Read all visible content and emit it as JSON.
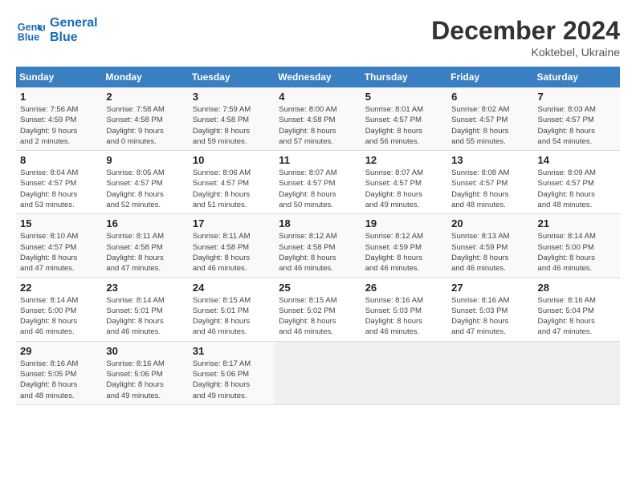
{
  "header": {
    "logo_line1": "General",
    "logo_line2": "Blue",
    "month": "December 2024",
    "location": "Koktebel, Ukraine"
  },
  "weekdays": [
    "Sunday",
    "Monday",
    "Tuesday",
    "Wednesday",
    "Thursday",
    "Friday",
    "Saturday"
  ],
  "weeks": [
    [
      {
        "day": "1",
        "sunrise": "7:56 AM",
        "sunset": "4:59 PM",
        "daylight": "9 hours and 2 minutes."
      },
      {
        "day": "2",
        "sunrise": "7:58 AM",
        "sunset": "4:58 PM",
        "daylight": "9 hours and 0 minutes."
      },
      {
        "day": "3",
        "sunrise": "7:59 AM",
        "sunset": "4:58 PM",
        "daylight": "8 hours and 59 minutes."
      },
      {
        "day": "4",
        "sunrise": "8:00 AM",
        "sunset": "4:58 PM",
        "daylight": "8 hours and 57 minutes."
      },
      {
        "day": "5",
        "sunrise": "8:01 AM",
        "sunset": "4:57 PM",
        "daylight": "8 hours and 56 minutes."
      },
      {
        "day": "6",
        "sunrise": "8:02 AM",
        "sunset": "4:57 PM",
        "daylight": "8 hours and 55 minutes."
      },
      {
        "day": "7",
        "sunrise": "8:03 AM",
        "sunset": "4:57 PM",
        "daylight": "8 hours and 54 minutes."
      }
    ],
    [
      {
        "day": "8",
        "sunrise": "8:04 AM",
        "sunset": "4:57 PM",
        "daylight": "8 hours and 53 minutes."
      },
      {
        "day": "9",
        "sunrise": "8:05 AM",
        "sunset": "4:57 PM",
        "daylight": "8 hours and 52 minutes."
      },
      {
        "day": "10",
        "sunrise": "8:06 AM",
        "sunset": "4:57 PM",
        "daylight": "8 hours and 51 minutes."
      },
      {
        "day": "11",
        "sunrise": "8:07 AM",
        "sunset": "4:57 PM",
        "daylight": "8 hours and 50 minutes."
      },
      {
        "day": "12",
        "sunrise": "8:07 AM",
        "sunset": "4:57 PM",
        "daylight": "8 hours and 49 minutes."
      },
      {
        "day": "13",
        "sunrise": "8:08 AM",
        "sunset": "4:57 PM",
        "daylight": "8 hours and 48 minutes."
      },
      {
        "day": "14",
        "sunrise": "8:09 AM",
        "sunset": "4:57 PM",
        "daylight": "8 hours and 48 minutes."
      }
    ],
    [
      {
        "day": "15",
        "sunrise": "8:10 AM",
        "sunset": "4:57 PM",
        "daylight": "8 hours and 47 minutes."
      },
      {
        "day": "16",
        "sunrise": "8:11 AM",
        "sunset": "4:58 PM",
        "daylight": "8 hours and 47 minutes."
      },
      {
        "day": "17",
        "sunrise": "8:11 AM",
        "sunset": "4:58 PM",
        "daylight": "8 hours and 46 minutes."
      },
      {
        "day": "18",
        "sunrise": "8:12 AM",
        "sunset": "4:58 PM",
        "daylight": "8 hours and 46 minutes."
      },
      {
        "day": "19",
        "sunrise": "8:12 AM",
        "sunset": "4:59 PM",
        "daylight": "8 hours and 46 minutes."
      },
      {
        "day": "20",
        "sunrise": "8:13 AM",
        "sunset": "4:59 PM",
        "daylight": "8 hours and 46 minutes."
      },
      {
        "day": "21",
        "sunrise": "8:14 AM",
        "sunset": "5:00 PM",
        "daylight": "8 hours and 46 minutes."
      }
    ],
    [
      {
        "day": "22",
        "sunrise": "8:14 AM",
        "sunset": "5:00 PM",
        "daylight": "8 hours and 46 minutes."
      },
      {
        "day": "23",
        "sunrise": "8:14 AM",
        "sunset": "5:01 PM",
        "daylight": "8 hours and 46 minutes."
      },
      {
        "day": "24",
        "sunrise": "8:15 AM",
        "sunset": "5:01 PM",
        "daylight": "8 hours and 46 minutes."
      },
      {
        "day": "25",
        "sunrise": "8:15 AM",
        "sunset": "5:02 PM",
        "daylight": "8 hours and 46 minutes."
      },
      {
        "day": "26",
        "sunrise": "8:16 AM",
        "sunset": "5:03 PM",
        "daylight": "8 hours and 46 minutes."
      },
      {
        "day": "27",
        "sunrise": "8:16 AM",
        "sunset": "5:03 PM",
        "daylight": "8 hours and 47 minutes."
      },
      {
        "day": "28",
        "sunrise": "8:16 AM",
        "sunset": "5:04 PM",
        "daylight": "8 hours and 47 minutes."
      }
    ],
    [
      {
        "day": "29",
        "sunrise": "8:16 AM",
        "sunset": "5:05 PM",
        "daylight": "8 hours and 48 minutes."
      },
      {
        "day": "30",
        "sunrise": "8:16 AM",
        "sunset": "5:06 PM",
        "daylight": "8 hours and 49 minutes."
      },
      {
        "day": "31",
        "sunrise": "8:17 AM",
        "sunset": "5:06 PM",
        "daylight": "8 hours and 49 minutes."
      },
      null,
      null,
      null,
      null
    ]
  ]
}
